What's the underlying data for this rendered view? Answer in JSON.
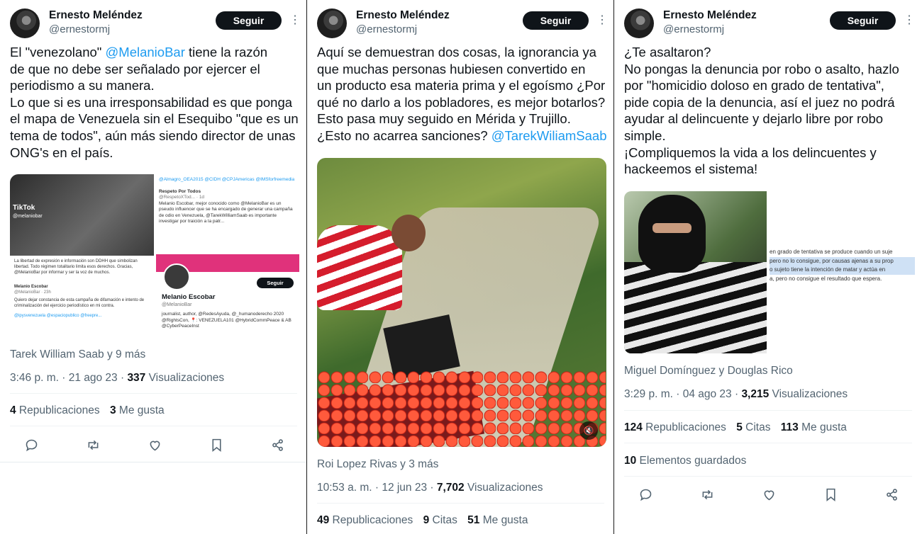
{
  "colors": {
    "accent": "#1d9bf0",
    "text": "#0f1419",
    "muted": "#536471",
    "follow_bg": "#0f1419"
  },
  "tweets": [
    {
      "author": "Ernesto Meléndez",
      "handle": "@ernestormj",
      "follow_label": "Seguir",
      "text_parts": [
        "El \"venezolano\" ",
        "@MelanioBar",
        " tiene la razón\nde que no debe ser señalado por ejercer el\nperiodismo a su manera.\nLo que si es una irresponsabilidad es que ponga\nel mapa de Venezuela sin el Esequibo \"que es un\ntema de todos\",  aún más siendo director de unas\nONG's en el país."
      ],
      "media": {
        "tiktok_label": "TikTok",
        "tiktok_user": "@melaniobar",
        "caption_top": "La libertad de expresión e información son DDHH que simbolizan libertad. Todo régimen totalitario limita esos derechos. Gracias, @MelanioBar por informar y ser la voz de muchos.",
        "quoted_name": "Melanio Escobar",
        "quoted_handle": "@MelanioBar · 23h",
        "quoted_text": "Quiero dejar constancia de esta campaña de difamación e intento de criminalización del ejercicio periodístico en mi contra.",
        "quoted_footer": "@ipysvenezuela @espaciopublico @freepre...",
        "right_tags": "@Almagro_OEA2015 @CIDH @CPJAmericas @IMSforfreemedia",
        "right_reply_name": "Respeto Por Todos",
        "right_reply_handle": "@RespetoXTod... · 1d",
        "right_reply_text": "Melanio Escobar, mejor conocido como @MelanioBar es un pseudo influencer que se ha encargado de generar una campaña de odio en Venezuela, @TarekWilliamSaab es importante investigar por traición a la patr...",
        "profile_follow": "Seguir",
        "profile_name": "Melanio Escobar",
        "profile_handle": "@MelanioBar",
        "profile_bio": "journalist, author, @RedesAyuda, @_humanoderecho 2020 @RightsCon, 📍: VENEZUELA101 @HybridCommPeace & AB @CyberPeaceInst"
      },
      "credit": "Tarek William Saab y 9 más",
      "time": "3:46 p. m. · 21 ago 23 · ",
      "views_count": "337",
      "views_label": " Visualizaciones",
      "stats": [
        {
          "count": "4",
          "label": " Republicaciones"
        },
        {
          "count": "3",
          "label": " Me gusta"
        }
      ]
    },
    {
      "author": "Ernesto Meléndez",
      "handle": "@ernestormj",
      "follow_label": "Seguir",
      "text_parts": [
        "Aquí se demuestran dos cosas, la ignorancia ya\nque muchas personas hubiesen convertido en\nun producto esa materia prima y el egoísmo ¿Por\nqué no darlo a los pobladores, es mejor botarlos?\nEsto pasa muy seguido en Mérida y Trujillo.\n¿Esto no acarrea sanciones? ",
        "@TarekWiliamSaab",
        ""
      ],
      "credit": "Roi Lopez Rivas y 3 más",
      "time": "10:53 a. m. · 12 jun 23 · ",
      "views_count": "7,702",
      "views_label": " Visualizaciones",
      "stats": [
        {
          "count": "49",
          "label": " Republicaciones"
        },
        {
          "count": "9",
          "label": " Citas"
        },
        {
          "count": "51",
          "label": " Me gusta"
        }
      ]
    },
    {
      "author": "Ernesto Meléndez",
      "handle": "@ernestormj",
      "follow_label": "Seguir",
      "text_parts": [
        "¿Te asaltaron?\nNo pongas la denuncia por robo o asalto, hazlo\npor \"homicidio doloso en grado de tentativa\",\npide copia de la denuncia, así el juez no podrá\nayudar al delincuente y dejarlo libre por robo\nsimple.\n¡Compliquemos la vida a los delincuentes y\nhackeemos el sistema!",
        "",
        ""
      ],
      "media": {
        "doc_lines": [
          "en grado de tentativa se produce cuando un suje",
          "pero no lo consigue, por causas ajenas a su prop",
          "o sujeto tiene la intención de matar y actúa en",
          "a, pero no consigue el resultado que espera."
        ]
      },
      "credit": "Miguel Domínguez y Douglas Rico",
      "time": "3:29 p. m. · 04 ago 23 · ",
      "views_count": "3,215",
      "views_label": " Visualizaciones",
      "stats": [
        {
          "count": "124",
          "label": " Republicaciones"
        },
        {
          "count": "5",
          "label": " Citas"
        },
        {
          "count": "113",
          "label": " Me gusta"
        }
      ],
      "saved_count": "10",
      "saved_label": " Elementos guardados"
    }
  ],
  "icons": [
    "reply-icon",
    "retweet-icon",
    "like-icon",
    "bookmark-icon",
    "share-icon",
    "more-icon",
    "mute-icon"
  ]
}
